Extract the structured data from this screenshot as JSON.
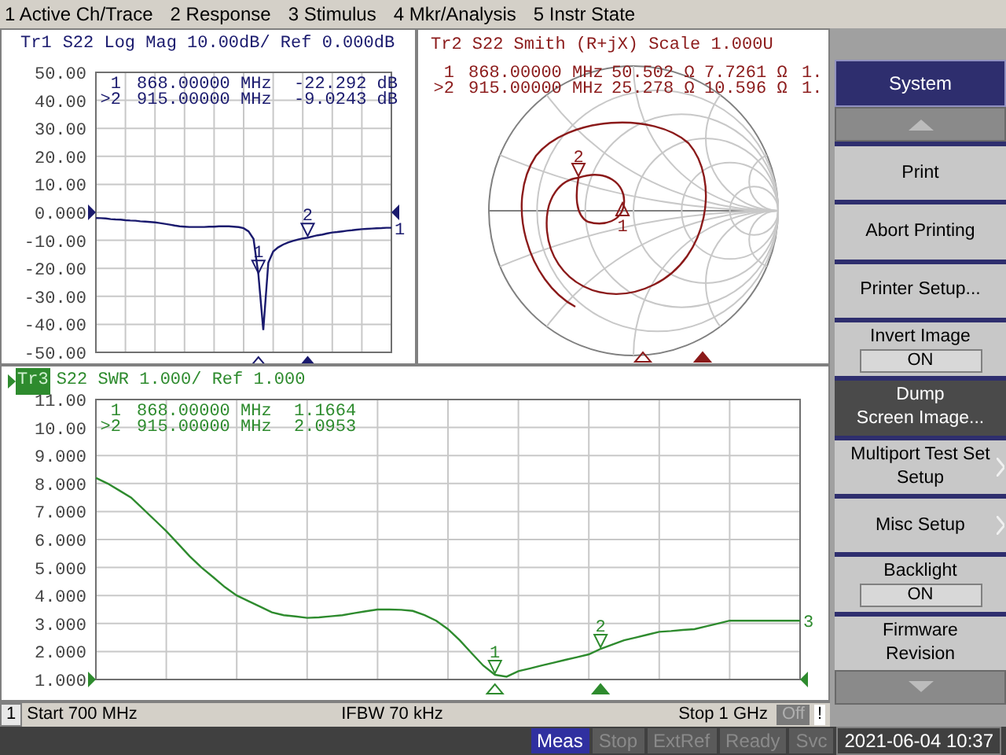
{
  "menu": [
    "1 Active Ch/Trace",
    "2 Response",
    "3 Stimulus",
    "4 Mkr/Analysis",
    "5 Instr State"
  ],
  "trace1": {
    "trace_tag": "1",
    "markers": [
      {
        "id": "1",
        "freq": "868.00000 MHz",
        "value": "-22.292 dB",
        "active": false
      },
      {
        "id": ">2",
        "freq": "915.00000 MHz",
        "value": "-9.0243 dB",
        "active": true
      }
    ],
    "chart_data": {
      "type": "line",
      "title": "S22 Log Mag 10.00dB/ Ref 0.000dB",
      "ylim": [
        -50,
        50
      ],
      "yticks": [
        {
          "value": 50,
          "label": "50.00"
        },
        {
          "value": 40,
          "label": "40.00"
        },
        {
          "value": 30,
          "label": "30.00"
        },
        {
          "value": 20,
          "label": "20.00"
        },
        {
          "value": 10,
          "label": "10.00"
        },
        {
          "value": 0,
          "label": "0.000"
        },
        {
          "value": -10,
          "label": "-10.00"
        },
        {
          "value": -20,
          "label": "-20.00"
        },
        {
          "value": -30,
          "label": "-30.00"
        },
        {
          "value": -40,
          "label": "-40.00"
        },
        {
          "value": -50,
          "label": "-50.00"
        }
      ],
      "categories": [
        null,
        null,
        null,
        null,
        null,
        null,
        null,
        null,
        null,
        null,
        null,
        null,
        null,
        null,
        null,
        null,
        null,
        null,
        null,
        null,
        null,
        null,
        null,
        null,
        null,
        null,
        null,
        null,
        null,
        null,
        null,
        null,
        null,
        null,
        null,
        null,
        null,
        null,
        null,
        null,
        null,
        null,
        null,
        null,
        null,
        null,
        null,
        null,
        null,
        null,
        null,
        null,
        null,
        null,
        null,
        null,
        null,
        null,
        null,
        null,
        null
      ],
      "series": [
        {
          "name": "Tr1",
          "color": "#1a1a6e",
          "values": [
            -2,
            -2.1,
            -2.2,
            -2.4,
            -2.5,
            -2.6,
            -2.8,
            -2.9,
            -3,
            -3.2,
            -3.3,
            -3.4,
            -3.6,
            -3.8,
            -4.1,
            -4.4,
            -4.7,
            -5,
            -5.1,
            -5.2,
            -5.2,
            -5.2,
            -5.2,
            -5.1,
            -5.1,
            -5,
            -5,
            -5,
            -5.1,
            -5.3,
            -5.7,
            -6.8,
            -9.5,
            -22.292,
            -42,
            -18,
            -14,
            -12.5,
            -11.5,
            -10.8,
            -10.2,
            -9.7,
            -9.3,
            -9.0243,
            -8.6,
            -8.2,
            -7.9,
            -7.5,
            -7.2,
            -7,
            -6.8,
            -6.6,
            -6.4,
            -6.2,
            -6,
            -5.9,
            -5.8,
            -5.7,
            -5.6,
            -5.5,
            -5.5
          ]
        }
      ],
      "grid": true,
      "annotations": [
        {
          "y": -22.292,
          "text": "1"
        },
        {
          "y": -9.0243,
          "text": "2"
        }
      ]
    }
  },
  "smith": {
    "title": "Tr2 S22 Smith (R+jX) Scale 1.000U",
    "markers": [
      {
        "id": "1",
        "freq": "868.00000 MHz",
        "r": "50.502 Ω",
        "x": "7.7261 Ω",
        "extra": "1.",
        "active": false
      },
      {
        "id": ">2",
        "freq": "915.00000 MHz",
        "r": "25.278 Ω",
        "x": "10.596 Ω",
        "extra": "1.",
        "active": true
      }
    ],
    "marker_tags": [
      "1",
      "2"
    ]
  },
  "trace3": {
    "trace_tag": "3",
    "markers": [
      {
        "id": "1",
        "freq": "868.00000 MHz",
        "value": "1.1664",
        "active": false
      },
      {
        "id": ">2",
        "freq": "915.00000 MHz",
        "value": "2.0953",
        "active": true
      }
    ],
    "chart_data": {
      "type": "line",
      "title": "S22 SWR 1.000/ Ref 1.000",
      "ylim": [
        1,
        11
      ],
      "yticks": [
        {
          "value": 11,
          "label": "11.00"
        },
        {
          "value": 10,
          "label": "10.00"
        },
        {
          "value": 9,
          "label": "9.000"
        },
        {
          "value": 8,
          "label": "8.000"
        },
        {
          "value": 7,
          "label": "7.000"
        },
        {
          "value": 6,
          "label": "6.000"
        },
        {
          "value": 5,
          "label": "5.000"
        },
        {
          "value": 4,
          "label": "4.000"
        },
        {
          "value": 3,
          "label": "3.000"
        },
        {
          "value": 2,
          "label": "2.000"
        },
        {
          "value": 1,
          "label": "1.000"
        }
      ],
      "categories": [
        null,
        null,
        null,
        null,
        null,
        null,
        null,
        null,
        null,
        null,
        null,
        null,
        null,
        null,
        null,
        null,
        null,
        null,
        null,
        null,
        null,
        null,
        null,
        null,
        null,
        null,
        null,
        null,
        null,
        null,
        null,
        null,
        null,
        null,
        null,
        null,
        null,
        null,
        null,
        null,
        null,
        null,
        null,
        null,
        null,
        null,
        null,
        null,
        null,
        null,
        null,
        null,
        null,
        null,
        null,
        null,
        null,
        null,
        null,
        null,
        null
      ],
      "series": [
        {
          "name": "Tr3",
          "color": "#2e8b2e",
          "values": [
            8.2,
            8.0,
            7.75,
            7.5,
            7.1,
            6.7,
            6.3,
            5.85,
            5.4,
            5.0,
            4.65,
            4.3,
            4.0,
            3.8,
            3.6,
            3.4,
            3.3,
            3.25,
            3.2,
            3.22,
            3.26,
            3.3,
            3.37,
            3.44,
            3.5,
            3.5,
            3.49,
            3.45,
            3.3,
            3.1,
            2.8,
            2.4,
            1.95,
            1.5,
            1.1664,
            1.1,
            1.3,
            1.4,
            1.5,
            1.6,
            1.7,
            1.8,
            1.9,
            2.0953,
            2.25,
            2.4,
            2.5,
            2.6,
            2.7,
            2.73,
            2.77,
            2.8,
            2.9,
            3.0,
            3.1,
            3.1,
            3.1,
            3.1,
            3.1,
            3.1,
            3.1
          ]
        }
      ],
      "grid": true,
      "annotations": [
        {
          "y": 1.1664,
          "text": "1"
        },
        {
          "y": 2.0953,
          "text": "2"
        }
      ]
    }
  },
  "channel_bar": {
    "channel": "1",
    "start": "Start 700 MHz",
    "ifbw": "IFBW 70 kHz",
    "stop": "Stop 1 GHz",
    "off": "Off",
    "warning": "!"
  },
  "softkeys": [
    {
      "kind": "header",
      "label": "System"
    },
    {
      "kind": "scroll-up"
    },
    {
      "kind": "button",
      "label": "Print",
      "selected": false
    },
    {
      "kind": "button",
      "label": "Abort Printing",
      "selected": false
    },
    {
      "kind": "button",
      "label": "Printer Setup...",
      "selected": false
    },
    {
      "kind": "toggle",
      "label": "Invert Image",
      "value": "ON",
      "selected": false
    },
    {
      "kind": "button",
      "label": "Dump\nScreen Image...",
      "selected": true
    },
    {
      "kind": "submenu",
      "label": "Multiport Test Set\nSetup",
      "selected": false
    },
    {
      "kind": "submenu",
      "label": "Misc Setup",
      "selected": false
    },
    {
      "kind": "toggle",
      "label": "Backlight",
      "value": "ON",
      "selected": false
    },
    {
      "kind": "button",
      "label": "Firmware\nRevision",
      "selected": false
    },
    {
      "kind": "scroll-down"
    }
  ],
  "status_bar": {
    "items": [
      {
        "label": "Meas",
        "active": true
      },
      {
        "label": "Stop",
        "active": false
      },
      {
        "label": "ExtRef",
        "active": false
      },
      {
        "label": "Ready",
        "active": false
      },
      {
        "label": "Svc",
        "active": false
      }
    ],
    "datetime": "2021-06-04 10:37"
  }
}
